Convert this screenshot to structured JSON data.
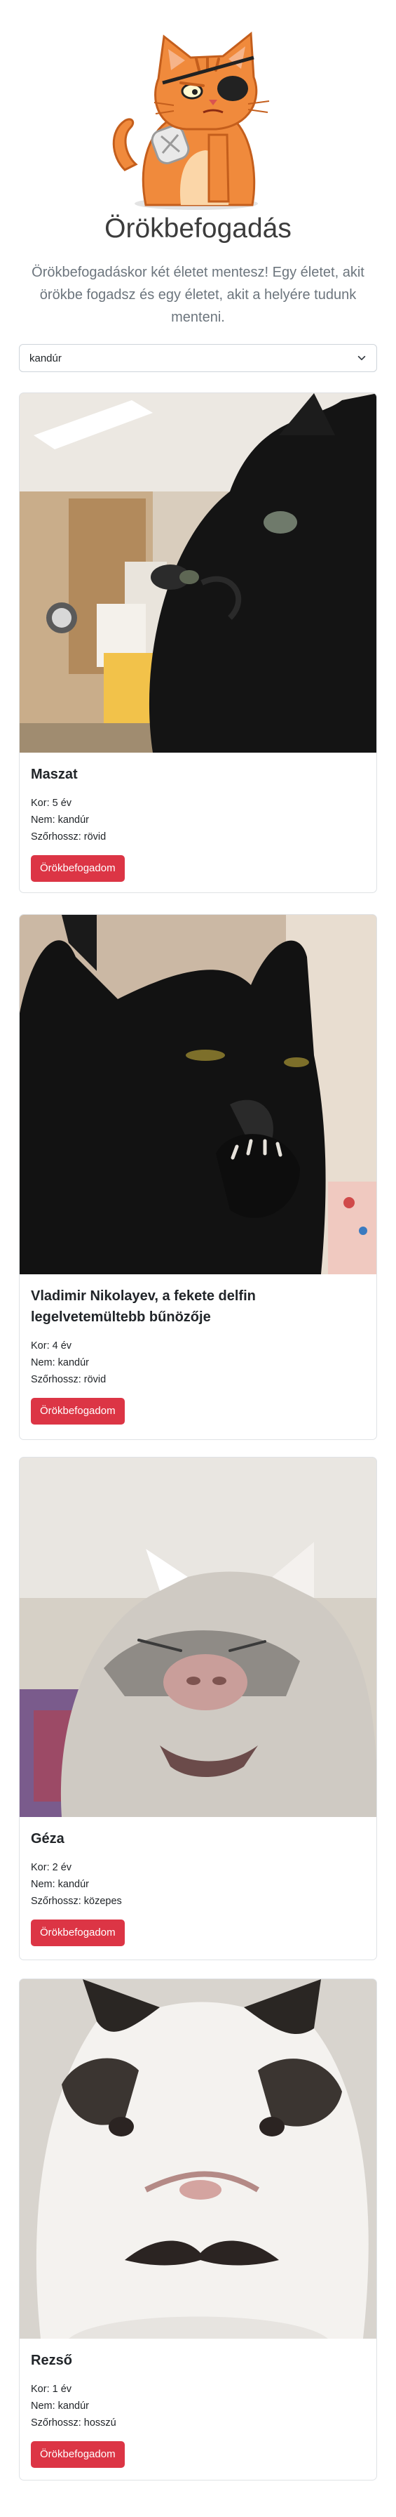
{
  "header": {
    "title": "Örökbefogadás",
    "lead": "Örökbefogadáskor két életet mentesz! Egy életet, akit örökbe fogadsz és egy életet, akit a helyére tudunk menteni."
  },
  "filter": {
    "selected": "kandúr"
  },
  "cats": [
    {
      "name": "Maszat",
      "age": "Kor: 5 év",
      "gender": "Nem: kandúr",
      "hair": "Szőrhossz: rövid",
      "button": "Örökbefogadom"
    },
    {
      "name": "Vladimir Nikolayev, a fekete delfin legelvetemültebb bűnözője",
      "age": "Kor: 4 év",
      "gender": "Nem: kandúr",
      "hair": "Szőrhossz: rövid",
      "button": "Örökbefogadom"
    },
    {
      "name": "Géza",
      "age": "Kor: 2 év",
      "gender": "Nem: kandúr",
      "hair": "Szőrhossz: közepes",
      "button": "Örökbefogadom"
    },
    {
      "name": "Rezső",
      "age": "Kor: 1 év",
      "gender": "Nem: kandúr",
      "hair": "Szőrhossz: hosszú",
      "button": "Örökbefogadom"
    }
  ],
  "colors": {
    "button": "#dc3545",
    "logo_orange": "#f08a3c"
  },
  "icons": [
    "cat-pirate-logo",
    "chevron-down-icon"
  ]
}
